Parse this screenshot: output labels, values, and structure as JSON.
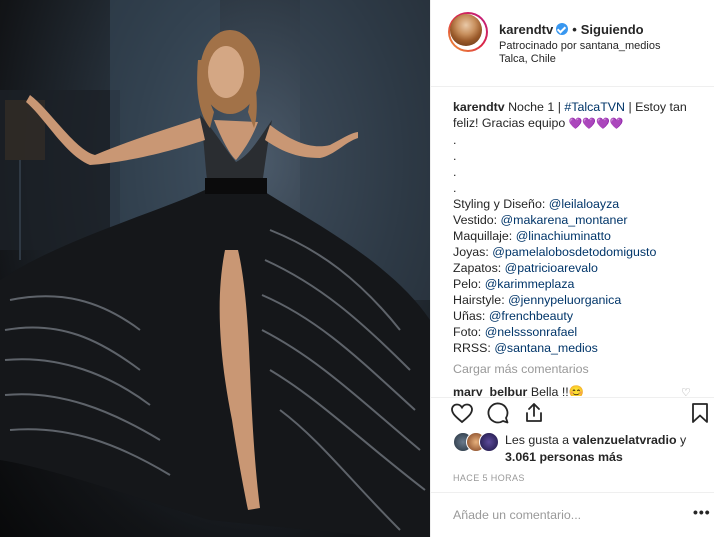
{
  "header": {
    "username": "karendtv",
    "follow_label": "Siguiendo",
    "separator": "•",
    "sponsored": "Patrocinado por santana_medios",
    "location": "Talca, Chile"
  },
  "caption": {
    "user": "karendtv",
    "text1": "Noche 1 |",
    "hashtag": "#TalcaTVN",
    "text2": "| Estoy tan",
    "text3": "feliz! Gracias equipo",
    "hearts": "💜💜💜💜",
    "dots": [
      ".",
      ".",
      ".",
      "."
    ],
    "credits": [
      {
        "label": "Styling y Diseño:",
        "handle": "@leilaloayza"
      },
      {
        "label": "Vestido:",
        "handle": "@makarena_montaner"
      },
      {
        "label": "Maquillaje:",
        "handle": "@linachiuminatto"
      },
      {
        "label": "Joyas:",
        "handle": "@pamelalobosdetodomigusto"
      },
      {
        "label": "Zapatos:",
        "handle": "@patricioarevalo"
      },
      {
        "label": "Pelo:",
        "handle": "@karimmeplaza"
      },
      {
        "label": "Hairstyle:",
        "handle": "@jennypeluorganica"
      },
      {
        "label": "Uñas:",
        "handle": "@frenchbeauty"
      },
      {
        "label": "Foto:",
        "handle": "@nelsssonrafael"
      },
      {
        "label": "RRSS:",
        "handle": "@santana_medios"
      }
    ]
  },
  "comments": {
    "load_more": "Cargar más comentarios",
    "first_user": "mary_belbur",
    "first_text": "Bella !!😊"
  },
  "likes": {
    "prefix": "Les gusta a",
    "user": "valenzuelatvradio",
    "conj": "y",
    "count_text": "3.061 personas más"
  },
  "timestamp": "HACE 5 HORAS",
  "add_comment_placeholder": "Añade un comentario...",
  "options_label": "•••",
  "colors": {
    "link": "#003569",
    "verified": "#3897f0",
    "muted": "#999999"
  },
  "icons": [
    "verified-badge-icon",
    "heart-icon",
    "comment-icon",
    "share-icon",
    "bookmark-icon",
    "options-icon"
  ]
}
